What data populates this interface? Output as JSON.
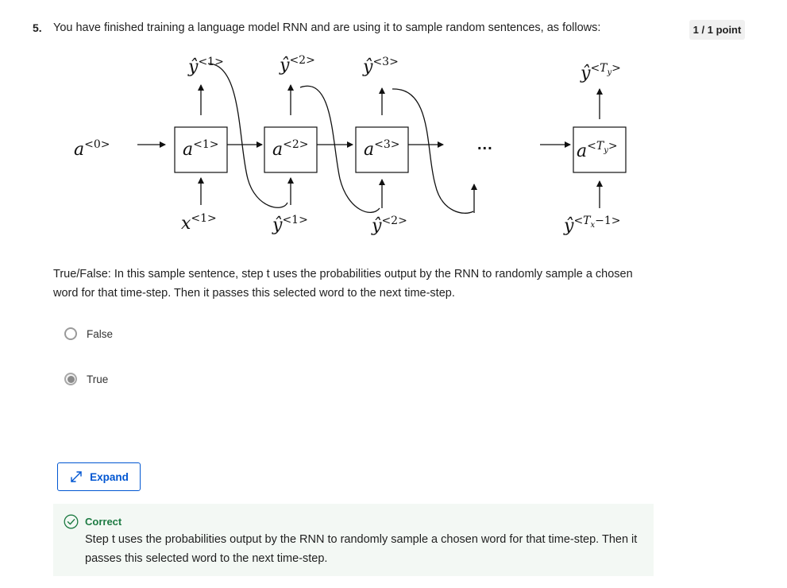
{
  "question": {
    "number": "5.",
    "text": "You have finished training a language model RNN and are using it to sample random sentences, as follows:",
    "points": "1 / 1 point"
  },
  "diagram": {
    "outputs": [
      {
        "symbol": "ŷ",
        "sup": "<1>"
      },
      {
        "symbol": "ŷ",
        "sup": "<2>"
      },
      {
        "symbol": "ŷ",
        "sup": "<3>"
      },
      {
        "symbol": "ŷ",
        "sup_parts": [
          "<",
          "T",
          "y",
          ">"
        ]
      }
    ],
    "activations": [
      {
        "symbol": "a",
        "sup": "<0>"
      },
      {
        "symbol": "a",
        "sup": "<1>"
      },
      {
        "symbol": "a",
        "sup": "<2>"
      },
      {
        "symbol": "a",
        "sup": "<3>"
      },
      {
        "symbol": "a",
        "sup_parts": [
          "<",
          "T",
          "y",
          ">"
        ]
      }
    ],
    "inputs": [
      {
        "symbol": "x",
        "sup": "<1>"
      },
      {
        "symbol": "ŷ",
        "sup": "<1>"
      },
      {
        "symbol": "ŷ",
        "sup": "<2>"
      },
      {
        "symbol": "ŷ",
        "sup_parts": [
          "<",
          "T",
          "x",
          "−1>"
        ]
      }
    ],
    "ellipsis": "..."
  },
  "statement": "True/False: In this sample sentence, step t uses the probabilities output by the RNN to randomly sample a chosen word for that time-step. Then it passes this selected word to the next time-step.",
  "options": [
    {
      "label": "False",
      "selected": false
    },
    {
      "label": "True",
      "selected": true
    }
  ],
  "expand": {
    "label": "Expand",
    "icon": "expand-arrows-icon"
  },
  "feedback": {
    "status": "Correct",
    "icon": "check-circle-icon",
    "text": "Step t uses the probabilities output by the RNN to randomly sample a chosen word for that time-step. Then it passes this selected word to the next time-step.",
    "color": "#1e7b43"
  },
  "colors": {
    "accent": "#0056d2",
    "success": "#1e7b43",
    "feedback_bg": "#f3f8f4"
  }
}
